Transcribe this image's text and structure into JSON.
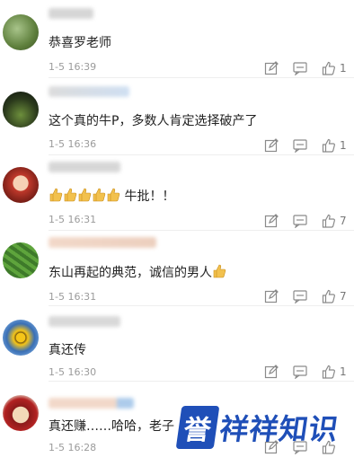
{
  "comments": [
    {
      "text": "恭喜罗老师",
      "time": "1-5 16:39",
      "likes": "1"
    },
    {
      "text": "这个真的牛P，多数人肯定选择破产了",
      "time": "1-5 16:36",
      "likes": "1"
    },
    {
      "text": "牛批！！",
      "time": "1-5 16:31",
      "likes": "7"
    },
    {
      "text": "东山再起的典范，诚信的男人",
      "time": "1-5 16:31",
      "likes": "7"
    },
    {
      "text": "真还传",
      "time": "1-5 16:30",
      "likes": "1"
    },
    {
      "text": "真还赚……哈哈，老子",
      "time": "1-5 16:28",
      "likes": ""
    }
  ],
  "watermark": {
    "boxed": "誉",
    "rest": "祥祥知识"
  }
}
